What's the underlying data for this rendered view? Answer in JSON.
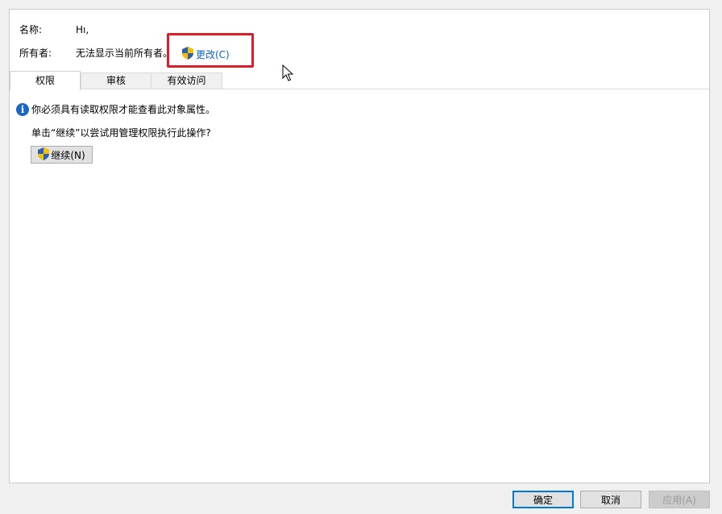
{
  "header": {
    "name_label": "名称:",
    "name_value": "Hı,",
    "owner_label": "所有者:",
    "owner_value": "无法显示当前所有者。",
    "change_link": "更改(C)"
  },
  "tabs": [
    {
      "label": "权限",
      "active": true
    },
    {
      "label": "审核",
      "active": false
    },
    {
      "label": "有效访问",
      "active": false
    }
  ],
  "content": {
    "info_message": "你必须具有读取权限才能查看此对象属性。",
    "prompt": "单击“继续”以尝试用管理权限执行此操作?",
    "continue_button": "继续(N)"
  },
  "footer": {
    "ok": "确定",
    "cancel": "取消",
    "apply": "应用(A)"
  },
  "colors": {
    "highlight_box": "#d9202a",
    "link": "#0a64c4",
    "info_icon": "#1a67c7",
    "default_button_border": "#0078d7"
  },
  "icons": [
    "uac-shield-icon",
    "info-icon",
    "mouse-cursor-icon"
  ]
}
